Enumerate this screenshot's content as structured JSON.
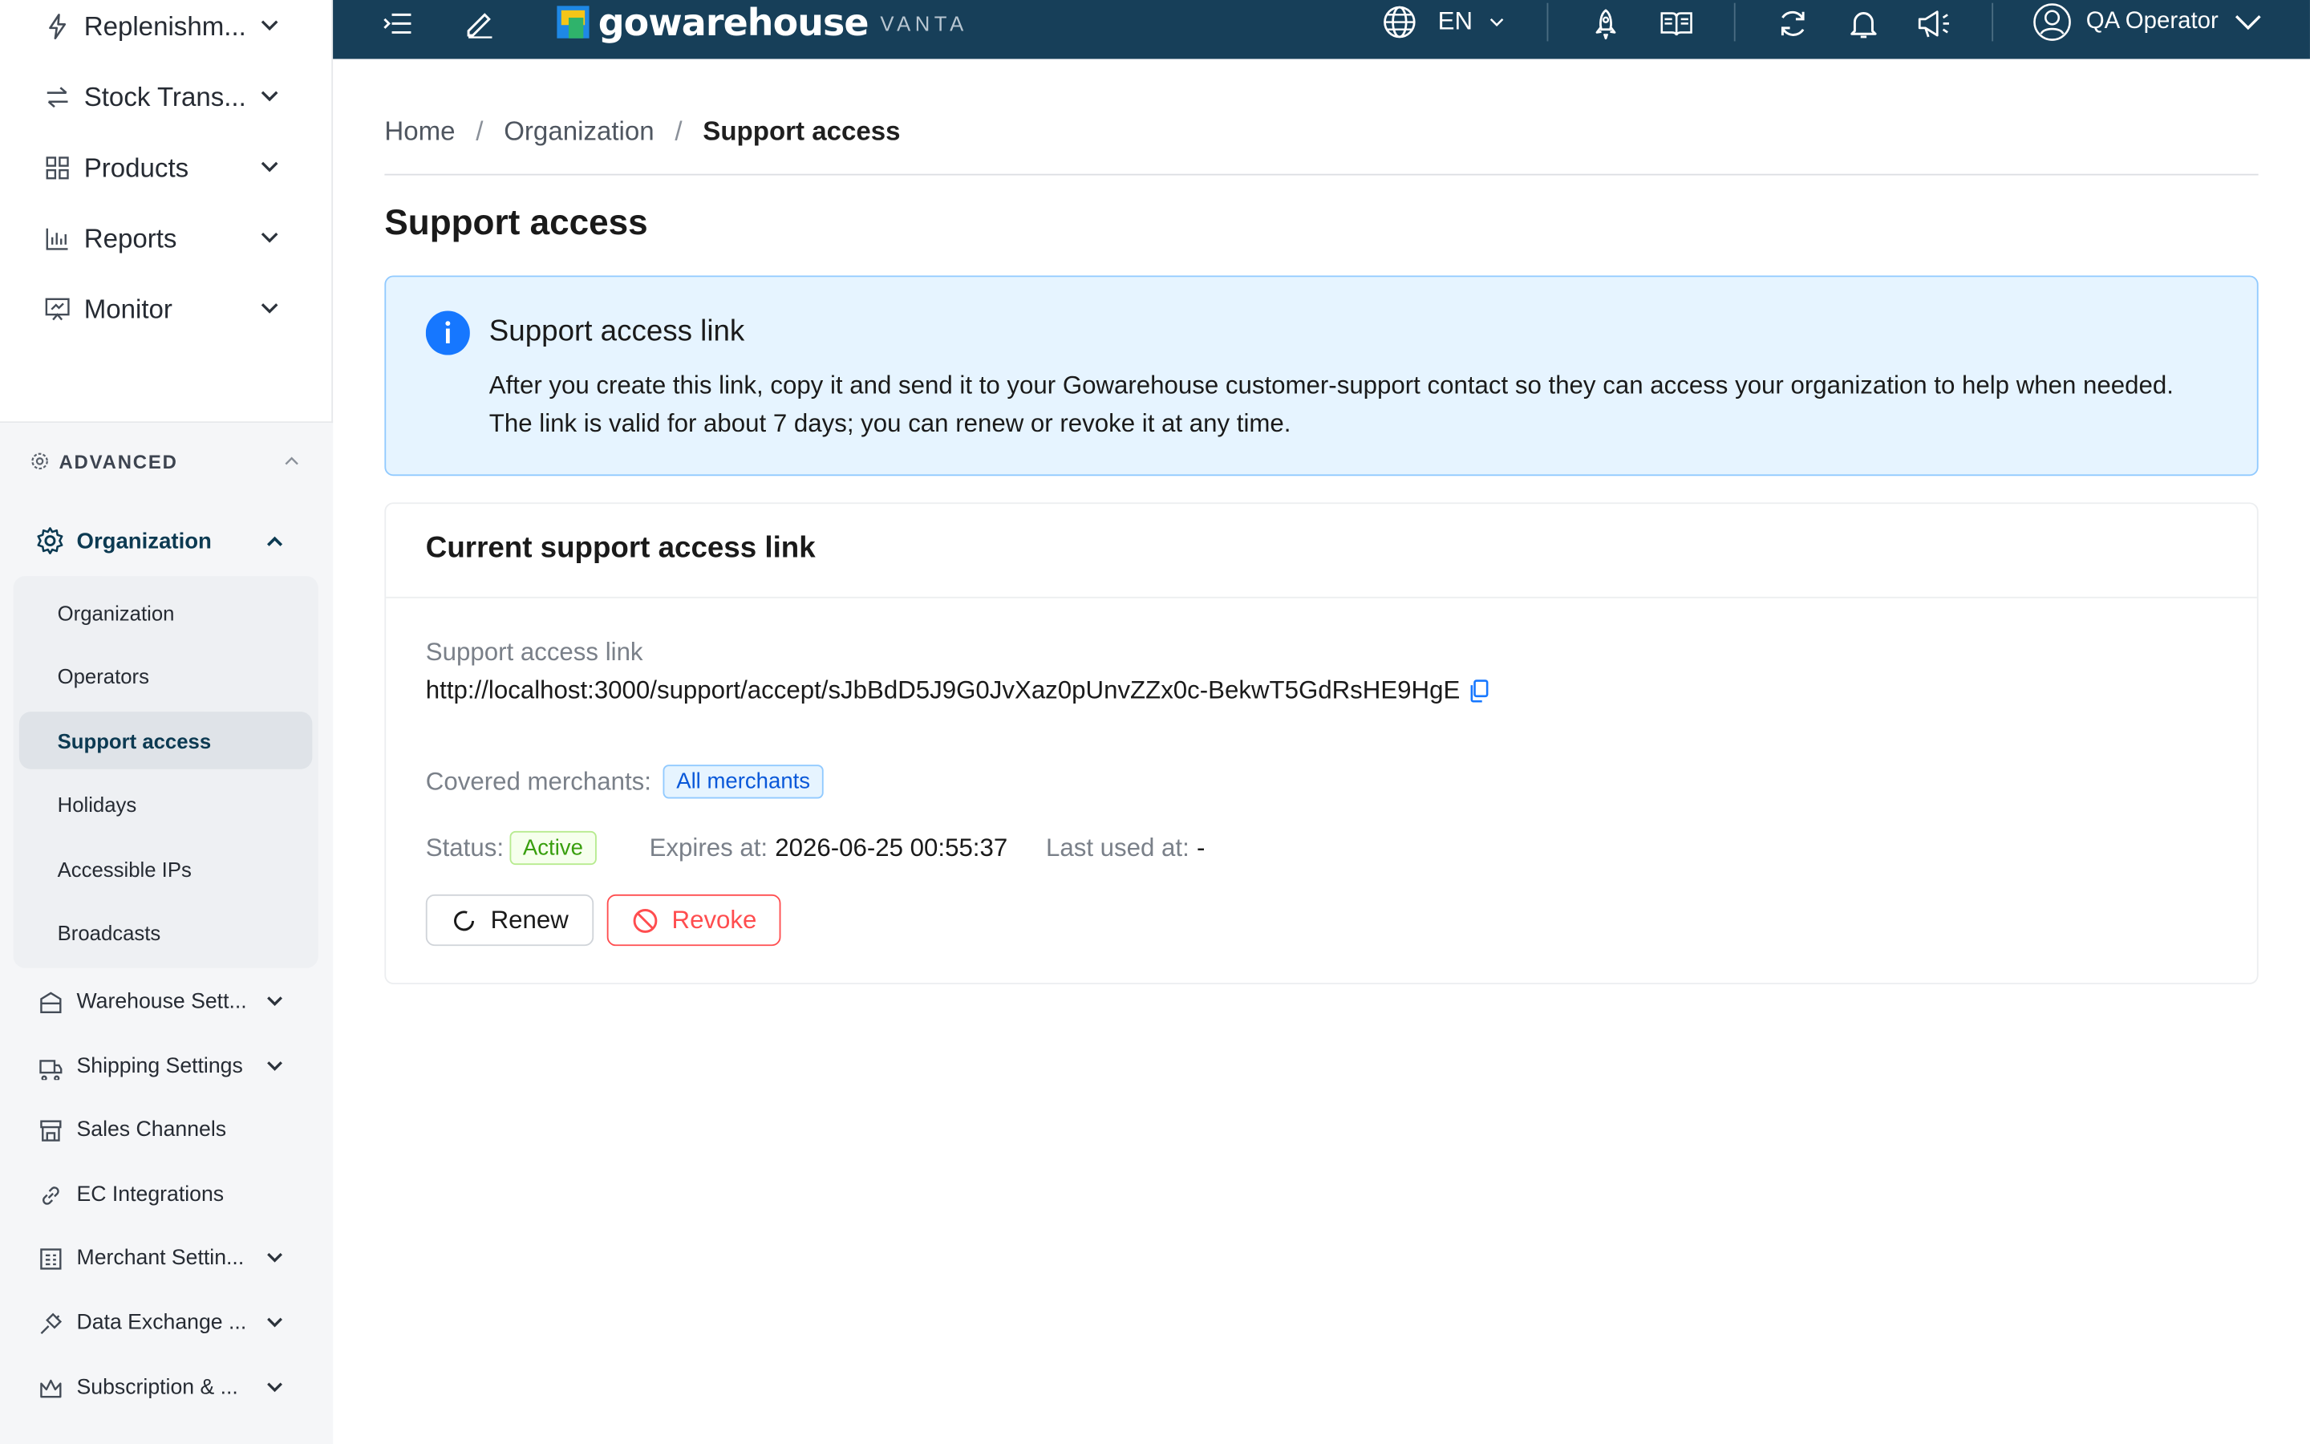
{
  "sidebar": {
    "top_items": [
      {
        "label": "Replenishm...",
        "icon": "lightning-icon"
      },
      {
        "label": "Stock Trans...",
        "icon": "transfer-icon"
      },
      {
        "label": "Products",
        "icon": "grid-icon"
      },
      {
        "label": "Reports",
        "icon": "bar-chart-icon"
      },
      {
        "label": "Monitor",
        "icon": "monitor-icon"
      }
    ],
    "advanced_title": "ADVANCED",
    "organization_label": "Organization",
    "org_sub_items": [
      {
        "label": "Organization",
        "active": false
      },
      {
        "label": "Operators",
        "active": false
      },
      {
        "label": "Support access",
        "active": true
      },
      {
        "label": "Holidays",
        "active": false
      },
      {
        "label": "Accessible IPs",
        "active": false
      },
      {
        "label": "Broadcasts",
        "active": false
      }
    ],
    "advanced_items": [
      {
        "label": "Warehouse Sett...",
        "icon": "warehouse-icon",
        "expandable": true
      },
      {
        "label": "Shipping Settings",
        "icon": "truck-icon",
        "expandable": true
      },
      {
        "label": "Sales Channels",
        "icon": "store-icon",
        "expandable": false
      },
      {
        "label": "EC Integrations",
        "icon": "link-icon",
        "expandable": false
      },
      {
        "label": "Merchant Settin...",
        "icon": "merchant-icon",
        "expandable": true
      },
      {
        "label": "Data Exchange ...",
        "icon": "plug-icon",
        "expandable": true
      },
      {
        "label": "Subscription & ...",
        "icon": "crown-icon",
        "expandable": true
      }
    ]
  },
  "topbar": {
    "logo_text": "gowarehouse",
    "logo_sub": "VANTA",
    "language": "EN",
    "user_name": "QA Operator",
    "colors": {
      "bar": "#173f59",
      "logo_blue": "#1e88e5",
      "logo_yellow": "#f5c518",
      "logo_green": "#2fb36b"
    }
  },
  "breadcrumb": {
    "home": "Home",
    "organization": "Organization",
    "current": "Support access"
  },
  "page_title": "Support access",
  "alert": {
    "title": "Support access link",
    "body": "After you create this link, copy it and send it to your Gowarehouse customer-support contact so they can access your organization to help when needed. The link is valid for about 7 days; you can renew or revoke it at any time."
  },
  "card": {
    "title": "Current support access link",
    "link_label": "Support access link",
    "link_value": "http://localhost:3000/support/accept/sJbBdD5J9G0JvXaz0pUnvZZx0c-BekwT5GdRsHE9HgE",
    "merchants_label": "Covered merchants:",
    "merchants_value": "All merchants",
    "status_label": "Status:",
    "status_value": "Active",
    "expires_label": "Expires at:",
    "expires_value": "2026-06-25 00:55:37",
    "last_used_label": "Last used at:",
    "last_used_value": "-",
    "renew_label": "Renew",
    "revoke_label": "Revoke"
  }
}
